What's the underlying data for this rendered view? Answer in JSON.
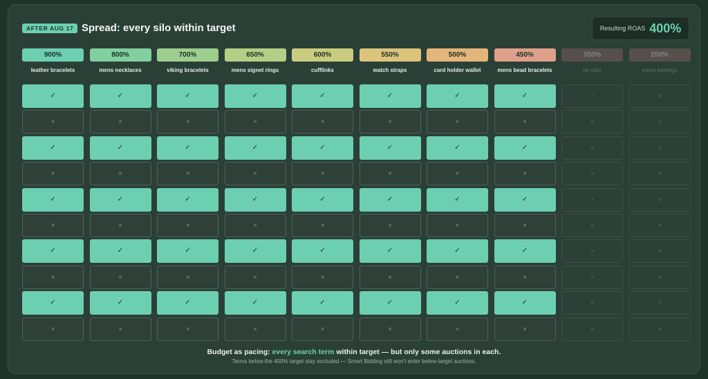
{
  "header": {
    "badge": "AFTER AUG 17",
    "title": "Spread: every silo within target",
    "roas_label": "Resulting ROAS",
    "roas_value": "400%"
  },
  "colors": {
    "accent": "#6dcfb2",
    "on_cell": "#6dcfb2",
    "off_cell": "#2f4039"
  },
  "silos": [
    {
      "pct": "900%",
      "name": "leather bracelets",
      "color": "#6dcfb2",
      "active": true
    },
    {
      "pct": "800%",
      "name": "mens necklaces",
      "color": "#82cf9f",
      "active": true
    },
    {
      "pct": "700%",
      "name": "viking bracelets",
      "color": "#9ccf8e",
      "active": true
    },
    {
      "pct": "650%",
      "name": "mens signet rings",
      "color": "#b3cf85",
      "active": true
    },
    {
      "pct": "600%",
      "name": "cufflinks",
      "color": "#c9cc7f",
      "active": true
    },
    {
      "pct": "550%",
      "name": "watch straps",
      "color": "#dcc47b",
      "active": true
    },
    {
      "pct": "500%",
      "name": "card holder wallet",
      "color": "#e4b57a",
      "active": true
    },
    {
      "pct": "450%",
      "name": "mens bead bracelets",
      "color": "#dea08a",
      "active": true
    },
    {
      "pct": "350%",
      "name": "tie clips",
      "color": "#574f4b",
      "active": false
    },
    {
      "pct": "250%",
      "name": "mens earrings",
      "color": "#574f4b",
      "active": false
    }
  ],
  "grid": {
    "rows": 10,
    "pattern": [
      true,
      false,
      true,
      false,
      true,
      false,
      true,
      false,
      true,
      false
    ],
    "check_symbol": "✓",
    "cross_symbol": "×"
  },
  "footer": {
    "main_prefix": "Budget as pacing: ",
    "main_highlight": "every search term",
    "main_suffix": " within target — but only some auctions in each.",
    "sub": "Terms below the 400% target stay excluded — Smart Bidding still won't enter below-target auctions."
  }
}
